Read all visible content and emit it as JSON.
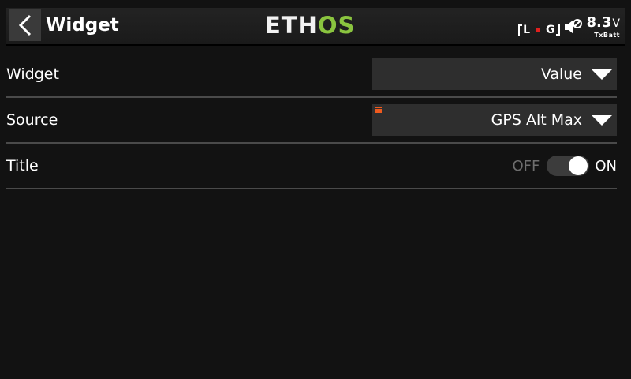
{
  "header": {
    "title": "Widget",
    "logo_left": "ETH",
    "logo_right": "OS",
    "logo_colors": {
      "left": "#f2f2f2",
      "right": "#8ac43f"
    },
    "status": {
      "lg_left": "L",
      "lg_right": "G",
      "battery_value": "8.3",
      "battery_unit": "V",
      "battery_label": "TxBatt"
    }
  },
  "rows": [
    {
      "label": "Widget",
      "type": "select",
      "value": "Value"
    },
    {
      "label": "Source",
      "type": "select",
      "value": "GPS Alt Max"
    },
    {
      "label": "Title",
      "type": "toggle",
      "off_label": "OFF",
      "on_label": "ON",
      "state": "on"
    }
  ],
  "icons": {
    "back": "chevron-left-icon",
    "speaker": "speaker-muted-icon",
    "dropdown": "triangle-down-icon",
    "source_marker": "menu-lines-icon"
  },
  "colors": {
    "background": "#121212",
    "accent_green": "#8ac43f",
    "marker_orange": "#f05a1e",
    "rec_red": "#e0201e"
  }
}
